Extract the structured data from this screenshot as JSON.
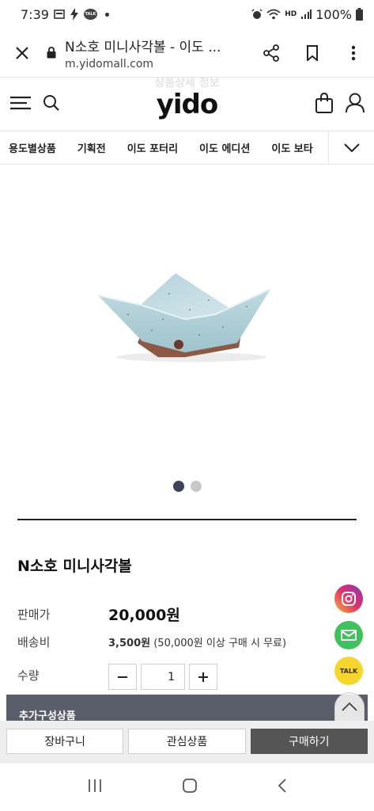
{
  "status_bar": {
    "time": "7:39",
    "battery": "100%",
    "hd_label": "HD",
    "talk_label": "TALK"
  },
  "browser": {
    "title": "N소호 미니사각볼 - 이도 ...",
    "url": "m.yidomall.com"
  },
  "header": {
    "ghost_text": "상품상세 정보",
    "logo": "yido"
  },
  "categories": [
    "용도별상품",
    "기획전",
    "이도 포터리",
    "이도 에디션",
    "이도 보타"
  ],
  "product": {
    "name": "N소호 미니사각볼",
    "price_label": "판매가",
    "price": "20,000원",
    "shipping_label": "배송비",
    "shipping_fee": "3,500원",
    "shipping_note": "(50,000원 이상 구매 시 무료)",
    "qty_label": "수량",
    "qty_value": "1",
    "addon_label": "추가구성상품"
  },
  "carousel": {
    "total": 2,
    "active": 1
  },
  "floating": {
    "talk_label": "TALK"
  },
  "actions": {
    "cart": "장바구니",
    "wishlist": "관심상품",
    "buy": "구매하기"
  },
  "colors": {
    "accent_dark": "#3c4358",
    "buy_button": "#555555",
    "addon_bar": "#5a5e6a",
    "instagram": "#e1306c",
    "mail": "#3fc25e",
    "kakao": "#f6d62d",
    "bowl": "#a9ccd6"
  }
}
